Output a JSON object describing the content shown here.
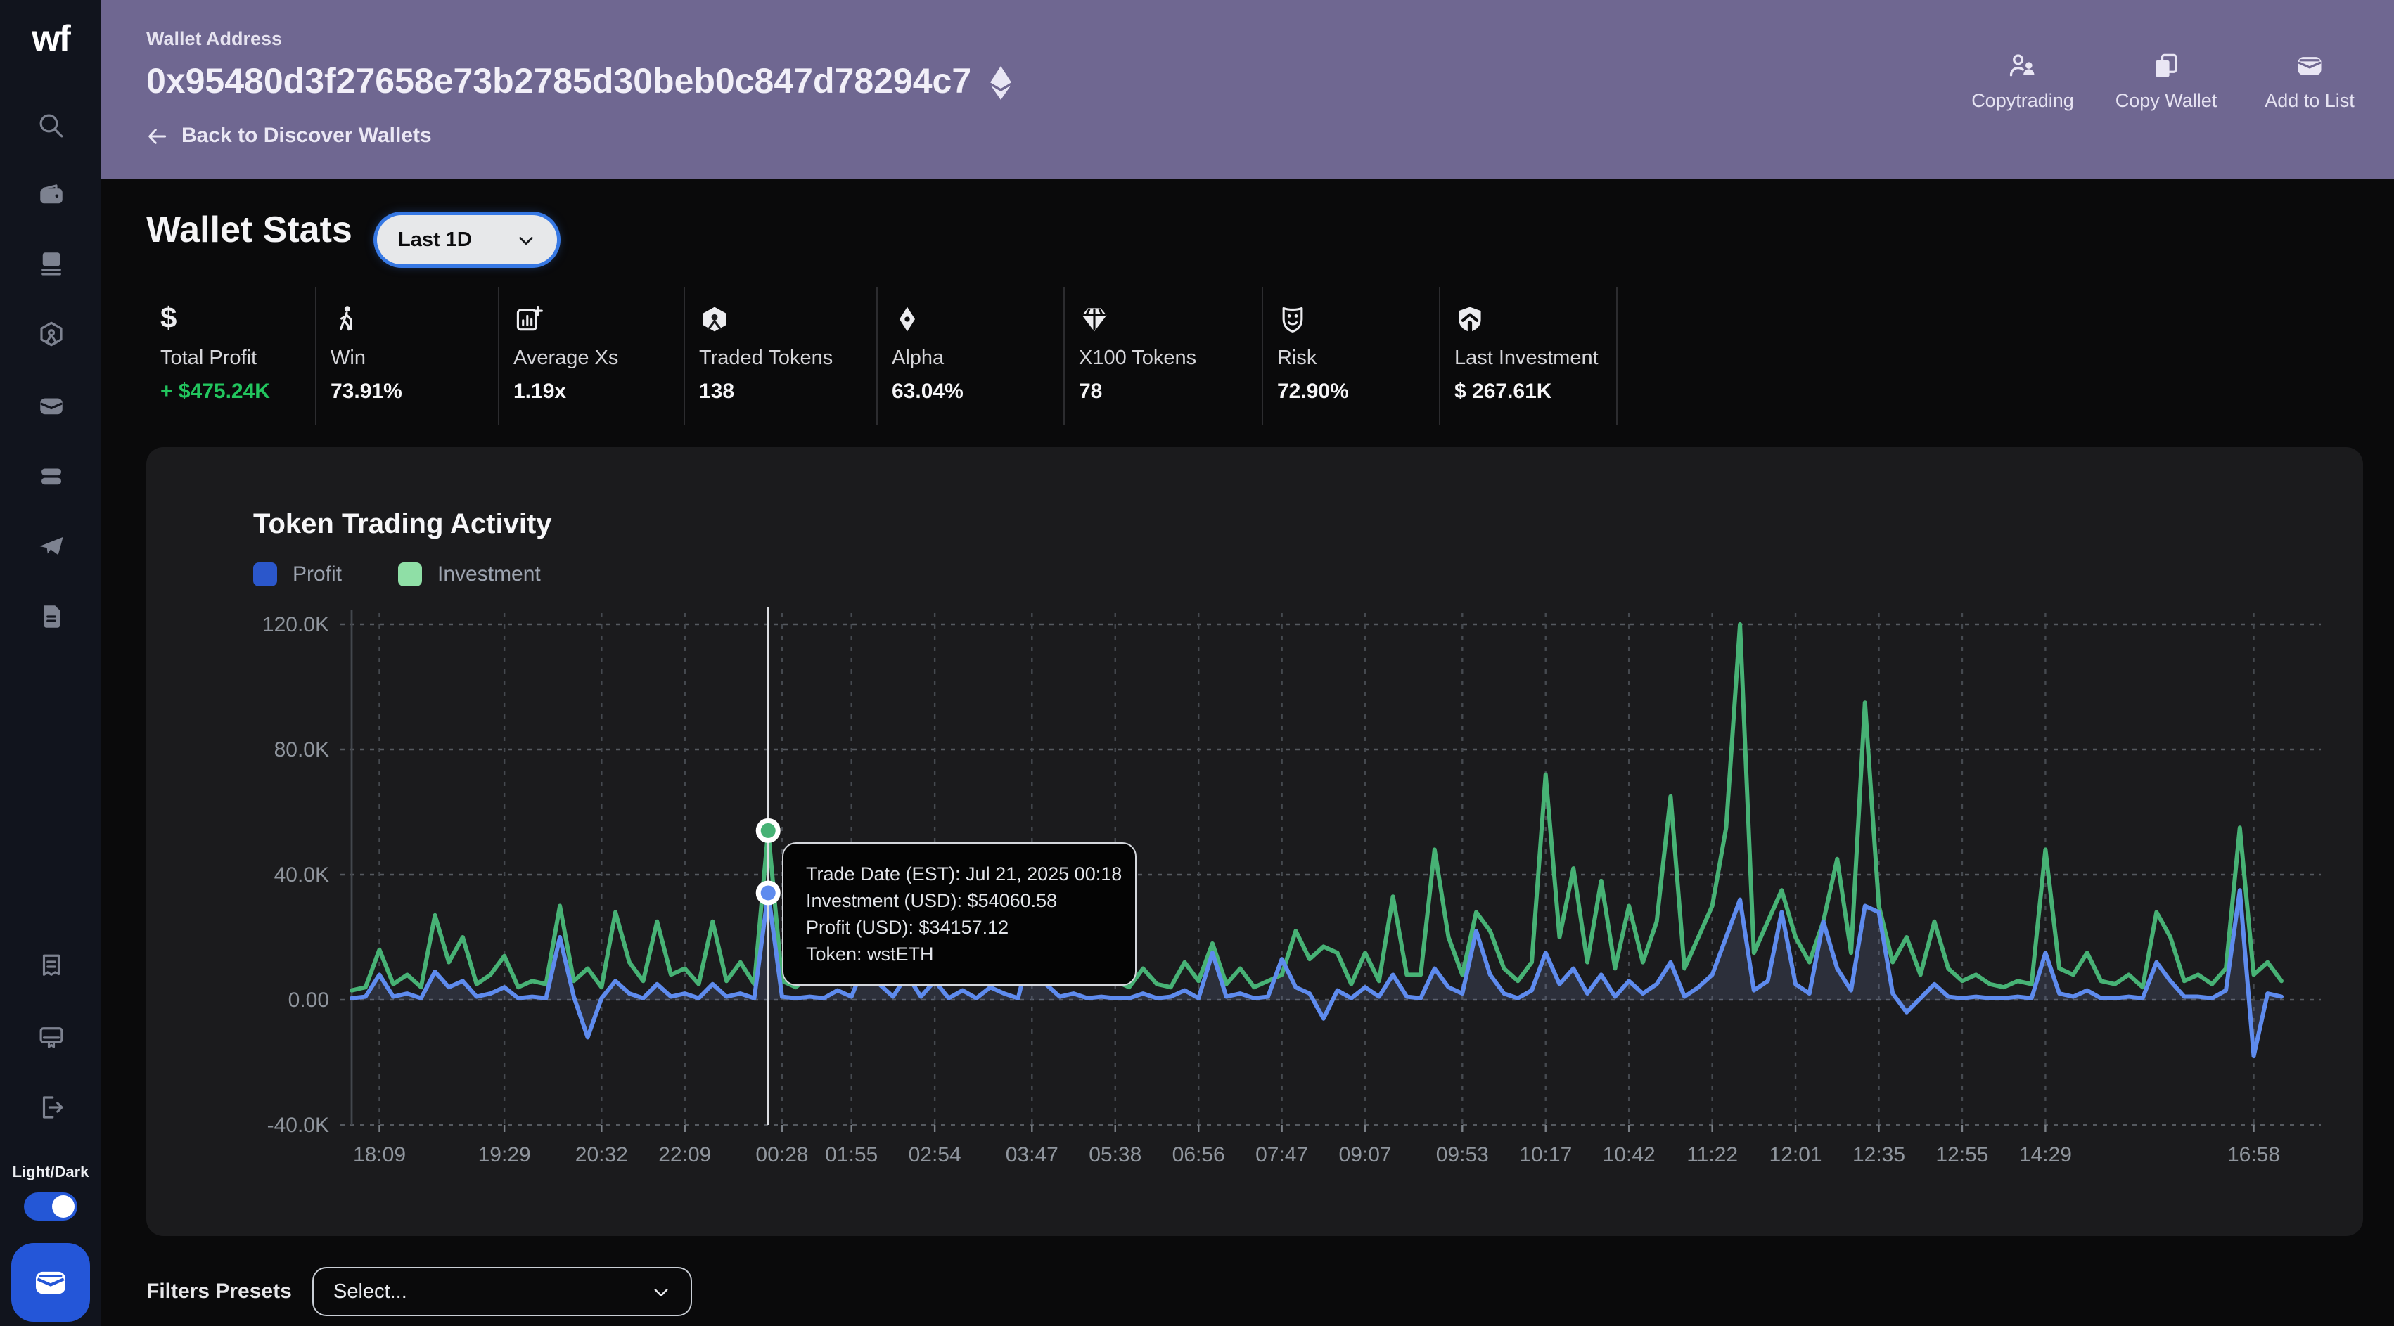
{
  "app": {
    "logo": "wf"
  },
  "header": {
    "label": "Wallet Address",
    "address": "0x95480d3f27658e73b2785d30beb0c847d78294c7",
    "back": "Back to Discover Wallets",
    "actions": [
      {
        "label": "Copytrading",
        "icon": "copytrading-users-icon"
      },
      {
        "label": "Copy Wallet",
        "icon": "copy-icon"
      },
      {
        "label": "Add to List",
        "icon": "wallet-card-icon"
      }
    ],
    "accent": "#6f6791"
  },
  "sidebar": {
    "toggle_label": "Light/Dark",
    "toggle_on": true,
    "toggle_color": "#2457d6",
    "icons": [
      "search",
      "wallet",
      "ledger",
      "token-cube",
      "card",
      "layers",
      "telegram",
      "document",
      "receipt",
      "monitor",
      "logout"
    ]
  },
  "stats": {
    "title": "Wallet Stats",
    "range": "Last 1D",
    "items": [
      {
        "label": "Total Profit",
        "value": "+ $475.24K",
        "icon": "dollar-icon",
        "value_color": "#22c55e"
      },
      {
        "label": "Win",
        "value": "73.91%",
        "icon": "walker-icon"
      },
      {
        "label": "Average Xs",
        "value": "1.19x",
        "icon": "chart-plus-icon"
      },
      {
        "label": "Traded Tokens",
        "value": "138",
        "icon": "token-cube-icon"
      },
      {
        "label": "Alpha",
        "value": "63.04%",
        "icon": "diamond-icon"
      },
      {
        "label": "X100 Tokens",
        "value": "78",
        "icon": "gem-icon"
      },
      {
        "label": "Risk",
        "value": "72.90%",
        "icon": "mask-icon"
      },
      {
        "label": "Last Investment",
        "value": "$ 267.61K",
        "icon": "shield-home-icon"
      }
    ]
  },
  "chart_data": {
    "type": "line",
    "title": "Token Trading Activity",
    "legend_position": "top-left",
    "grid": true,
    "ylim": [
      -40000,
      120000
    ],
    "y_ticks": [
      "120.0K",
      "80.0K",
      "40.0K",
      "0.00",
      "-40.0K"
    ],
    "y_tick_values": [
      120000,
      80000,
      40000,
      0,
      -40000
    ],
    "x_tick_labels": [
      "18:09",
      "19:29",
      "20:32",
      "22:09",
      "00:28",
      "01:55",
      "02:54",
      "03:47",
      "05:38",
      "06:56",
      "07:47",
      "09:07",
      "09:53",
      "10:17",
      "10:42",
      "11:22",
      "12:01",
      "12:35",
      "12:55",
      "14:29",
      "16:58"
    ],
    "x_tick_indices": [
      2,
      11,
      18,
      24,
      31,
      36,
      42,
      49,
      55,
      61,
      67,
      73,
      80,
      86,
      92,
      98,
      104,
      110,
      116,
      122,
      137
    ],
    "legend": [
      {
        "name": "Profit",
        "color": "#2b57cb"
      },
      {
        "name": "Investment",
        "color": "#8fdfa6"
      }
    ],
    "series": [
      {
        "name": "Profit",
        "color": "#5e8bee",
        "values": [
          500,
          1000,
          8000,
          1000,
          2000,
          500,
          9000,
          4000,
          6000,
          1000,
          2000,
          4000,
          500,
          1000,
          500,
          20000,
          1000,
          -12000,
          500,
          6000,
          2000,
          500,
          5000,
          1000,
          2000,
          500,
          5000,
          1000,
          2000,
          500,
          34157.12,
          1000,
          500,
          1000,
          500,
          3000,
          1000,
          12000,
          5000,
          1000,
          8000,
          1000,
          6000,
          500,
          3000,
          500,
          4000,
          2000,
          500,
          18000,
          5000,
          1000,
          2000,
          500,
          1000,
          500,
          500,
          2000,
          500,
          1000,
          3000,
          500,
          15000,
          1000,
          2000,
          500,
          1000,
          13000,
          4000,
          2000,
          -6000,
          3000,
          500,
          4000,
          1000,
          8000,
          1000,
          500,
          10000,
          4000,
          2000,
          22000,
          8000,
          2000,
          500,
          3000,
          15000,
          5000,
          10000,
          2000,
          8000,
          1000,
          6000,
          2000,
          5000,
          12000,
          1000,
          4000,
          8000,
          20000,
          32000,
          3000,
          6000,
          28000,
          5000,
          2000,
          25000,
          10000,
          3000,
          30000,
          28000,
          2000,
          -4000,
          500,
          5000,
          1000,
          500,
          1000,
          500,
          500,
          1000,
          500,
          15000,
          2000,
          1000,
          3000,
          500,
          500,
          1000,
          500,
          12000,
          6000,
          1000,
          1000,
          500,
          3000,
          35000,
          -18000,
          2000,
          1000
        ]
      },
      {
        "name": "Investment",
        "color": "#47b275",
        "values": [
          3000,
          4000,
          16000,
          5000,
          8000,
          4000,
          27000,
          12000,
          20000,
          5000,
          8000,
          14000,
          4000,
          6000,
          5000,
          30000,
          6000,
          10000,
          4000,
          28000,
          12000,
          6000,
          25000,
          8000,
          10000,
          5000,
          25000,
          6000,
          12000,
          5000,
          54060.58,
          6000,
          4000,
          8000,
          5000,
          14000,
          6000,
          28000,
          20000,
          6000,
          30000,
          8000,
          25000,
          6000,
          15000,
          5000,
          22000,
          12000,
          6000,
          13000,
          20000,
          8000,
          12000,
          5000,
          8000,
          6000,
          4000,
          10000,
          5000,
          4000,
          12000,
          6000,
          18000,
          5000,
          10000,
          4000,
          6000,
          8000,
          22000,
          13000,
          17000,
          15000,
          5000,
          15000,
          6000,
          33000,
          8000,
          8000,
          48000,
          20000,
          8000,
          28000,
          22000,
          10000,
          6000,
          12000,
          72000,
          20000,
          42000,
          12000,
          38000,
          10000,
          30000,
          12000,
          25000,
          65000,
          10000,
          20000,
          30000,
          55000,
          120000,
          15000,
          25000,
          35000,
          20000,
          12000,
          25000,
          45000,
          15000,
          95000,
          30000,
          12000,
          20000,
          8000,
          25000,
          10000,
          6000,
          8000,
          5000,
          4000,
          6000,
          5000,
          48000,
          10000,
          8000,
          15000,
          6000,
          5000,
          8000,
          4000,
          28000,
          20000,
          6000,
          8000,
          5000,
          10000,
          55000,
          8000,
          12000,
          6000
        ]
      }
    ],
    "highlight": {
      "index": 30,
      "investment": 54060.58,
      "profit": 34157.12
    },
    "tooltip": {
      "lines": [
        "Trade Date (EST): Jul 21, 2025 00:18",
        "Investment (USD): $54060.58",
        "Profit (USD): $34157.12",
        "Token: wstETH"
      ]
    }
  },
  "filters": {
    "label": "Filters Presets",
    "placeholder": "Select..."
  }
}
